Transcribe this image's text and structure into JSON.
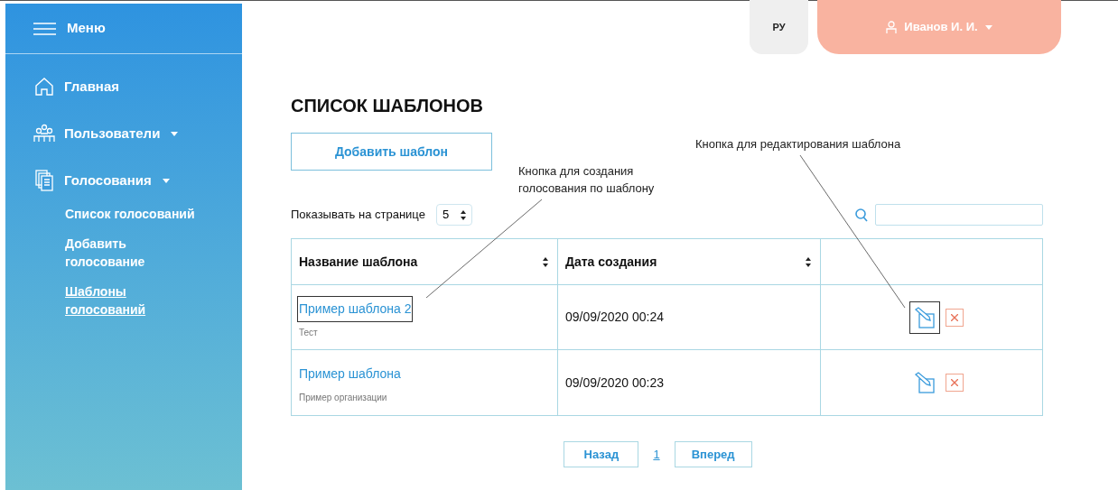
{
  "sidebar": {
    "menu_label": "Меню",
    "items": [
      {
        "label": "Главная",
        "kind": "home",
        "dropdown": false
      },
      {
        "label": "Пользователи",
        "kind": "users",
        "dropdown": true
      },
      {
        "label": "Голосования",
        "kind": "docs",
        "dropdown": true
      }
    ],
    "subitems": [
      {
        "label": "Список голосований",
        "selected": false
      },
      {
        "label": "Добавить голосование",
        "selected": false
      },
      {
        "label": "Шаблоны голосований",
        "selected": true
      }
    ]
  },
  "header": {
    "language": "РУ",
    "user": "Иванов И. И."
  },
  "title": "СПИСОК ШАБЛОНОВ",
  "add_button": "Добавить шаблон",
  "page_size": {
    "label": "Показывать на странице",
    "value": "5"
  },
  "table": {
    "columns": [
      "Название шаблона",
      "Дата создания"
    ],
    "rows": [
      {
        "name": "Пример шаблона 2",
        "subtitle": "Тест",
        "date": "09/09/2020 00:24",
        "name_outlined": true,
        "edit_outlined": true
      },
      {
        "name": "Пример шаблона",
        "subtitle": "Пример организации",
        "date": "09/09/2020 00:23",
        "name_outlined": false,
        "edit_outlined": false
      }
    ]
  },
  "pagination": {
    "prev": "Назад",
    "page": "1",
    "next": "Вперед"
  },
  "annotations": [
    {
      "text": "Кнопка для создания голосования по шаблону",
      "kind": "name"
    },
    {
      "text": "Кнопка для редактирования шаблона",
      "kind": "edit"
    }
  ]
}
